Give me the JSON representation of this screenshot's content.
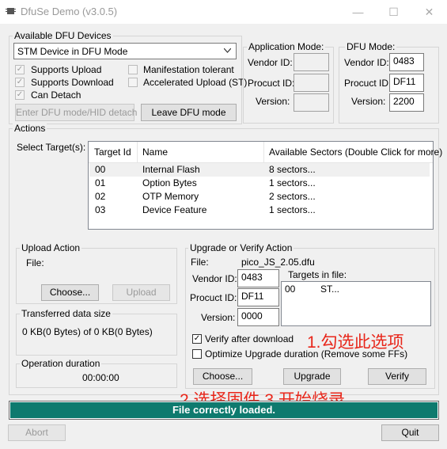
{
  "window": {
    "title": "DfuSe Demo (v3.0.5)",
    "controls": {
      "minimize": "—",
      "maximize": "☐",
      "close": "✕"
    }
  },
  "devices": {
    "group_label": "Available DFU Devices",
    "selected_device": "STM Device in DFU Mode",
    "checks": {
      "supports_upload": {
        "label": "Supports Upload",
        "checked": true
      },
      "supports_download": {
        "label": "Supports Download",
        "checked": true
      },
      "can_detach": {
        "label": "Can Detach",
        "checked": true
      },
      "manifestation_tolerant": {
        "label": "Manifestation tolerant",
        "checked": false
      },
      "accelerated_upload": {
        "label": "Accelerated Upload (ST)",
        "checked": false
      }
    },
    "enter_dfu_button": "Enter DFU mode/HID detach",
    "leave_dfu_button": "Leave DFU mode"
  },
  "app_mode": {
    "group_label": "Application Mode:",
    "vendor_label": "Vendor ID:",
    "product_label": "Procuct ID:",
    "version_label": "Version:",
    "vendor_value": "",
    "product_value": "",
    "version_value": ""
  },
  "dfu_mode": {
    "group_label": "DFU Mode:",
    "vendor_label": "Vendor ID:",
    "product_label": "Procuct ID:",
    "version_label": "Version:",
    "vendor_value": "0483",
    "product_value": "DF11",
    "version_value": "2200"
  },
  "actions": {
    "group_label": "Actions",
    "select_targets_label": "Select Target(s):",
    "columns": [
      "Target Id",
      "Name",
      "Available Sectors (Double Click for more)"
    ],
    "rows": [
      {
        "id": "00",
        "name": "Internal Flash",
        "sectors": "8 sectors..."
      },
      {
        "id": "01",
        "name": "Option Bytes",
        "sectors": "1 sectors..."
      },
      {
        "id": "02",
        "name": "OTP Memory",
        "sectors": "2 sectors..."
      },
      {
        "id": "03",
        "name": "Device Feature",
        "sectors": "1 sectors..."
      }
    ]
  },
  "upload_action": {
    "group_label": "Upload Action",
    "file_label": "File:",
    "choose_button": "Choose...",
    "upload_button": "Upload"
  },
  "transferred": {
    "group_label": "Transferred data size",
    "value": "0 KB(0 Bytes) of 0 KB(0 Bytes)"
  },
  "duration": {
    "group_label": "Operation duration",
    "value": "00:00:00"
  },
  "upgrade_action": {
    "group_label": "Upgrade or Verify Action",
    "file_label": "File:",
    "file_value": "pico_JS_2.05.dfu",
    "vendor_label": "Vendor ID:",
    "vendor_value": "0483",
    "product_label": "Procuct ID:",
    "product_value": "DF11",
    "version_label": "Version:",
    "version_value": "0000",
    "targets_label": "Targets in file:",
    "target_id": "00",
    "target_name": "ST...",
    "verify_after_download": {
      "label": "Verify after download",
      "checked": true
    },
    "optimize_upgrade": {
      "label": "Optimize Upgrade duration (Remove some FFs)",
      "checked": false
    },
    "choose_button": "Choose...",
    "upgrade_button": "Upgrade",
    "verify_button": "Verify"
  },
  "annotations": {
    "step1": "1.勾选此选项",
    "step23": "2.选择固件 3.开始烧录"
  },
  "progress": {
    "text": "File correctly loaded.",
    "fraction": 1.0,
    "color": "#0e7a6e"
  },
  "footer": {
    "abort_button": "Abort",
    "quit_button": "Quit"
  }
}
